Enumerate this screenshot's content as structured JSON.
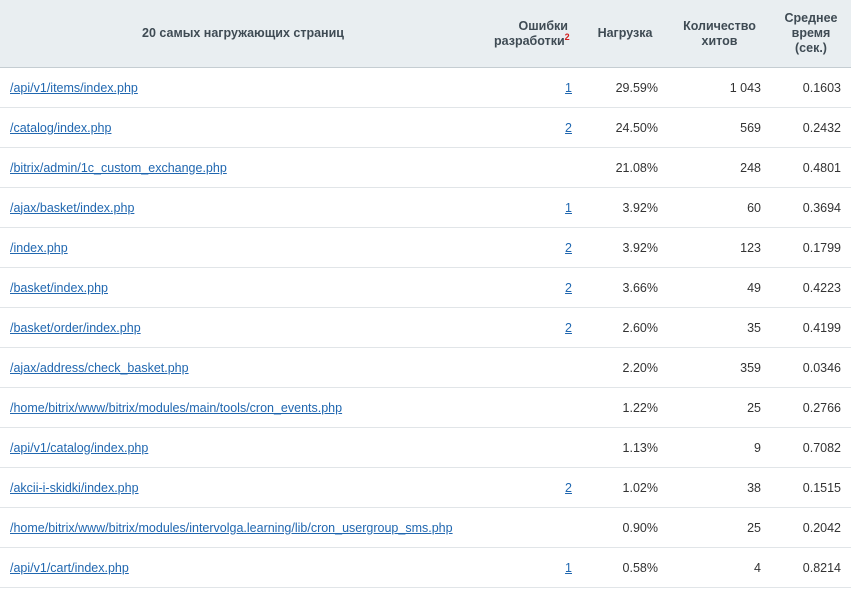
{
  "header": {
    "page": "20 самых нагружающих страниц",
    "errors_line1": "Ошибки",
    "errors_line2": "разработки",
    "errors_note": "2",
    "load": "Нагрузка",
    "hits_line1": "Количество",
    "hits_line2": "хитов",
    "time_line1": "Среднее",
    "time_line2": "время",
    "time_line3": "(сек.)"
  },
  "rows": [
    {
      "page": "/api/v1/items/index.php",
      "errors": "1",
      "load": "29.59%",
      "hits": "1 043",
      "time": "0.1603"
    },
    {
      "page": "/catalog/index.php",
      "errors": "2",
      "load": "24.50%",
      "hits": "569",
      "time": "0.2432"
    },
    {
      "page": "/bitrix/admin/1c_custom_exchange.php",
      "errors": "",
      "load": "21.08%",
      "hits": "248",
      "time": "0.4801"
    },
    {
      "page": "/ajax/basket/index.php",
      "errors": "1",
      "load": "3.92%",
      "hits": "60",
      "time": "0.3694"
    },
    {
      "page": "/index.php",
      "errors": "2",
      "load": "3.92%",
      "hits": "123",
      "time": "0.1799"
    },
    {
      "page": "/basket/index.php",
      "errors": "2",
      "load": "3.66%",
      "hits": "49",
      "time": "0.4223"
    },
    {
      "page": "/basket/order/index.php",
      "errors": "2",
      "load": "2.60%",
      "hits": "35",
      "time": "0.4199"
    },
    {
      "page": "/ajax/address/check_basket.php",
      "errors": "",
      "load": "2.20%",
      "hits": "359",
      "time": "0.0346"
    },
    {
      "page": "/home/bitrix/www/bitrix/modules/main/tools/cron_events.php",
      "errors": "",
      "load": "1.22%",
      "hits": "25",
      "time": "0.2766"
    },
    {
      "page": "/api/v1/catalog/index.php",
      "errors": "",
      "load": "1.13%",
      "hits": "9",
      "time": "0.7082"
    },
    {
      "page": "/akcii-i-skidki/index.php",
      "errors": "2",
      "load": "1.02%",
      "hits": "38",
      "time": "0.1515"
    },
    {
      "page": "/home/bitrix/www/bitrix/modules/intervolga.learning/lib/cron_usergroup_sms.php",
      "errors": "",
      "load": "0.90%",
      "hits": "25",
      "time": "0.2042"
    },
    {
      "page": "/api/v1/cart/index.php",
      "errors": "1",
      "load": "0.58%",
      "hits": "4",
      "time": "0.8214"
    }
  ]
}
